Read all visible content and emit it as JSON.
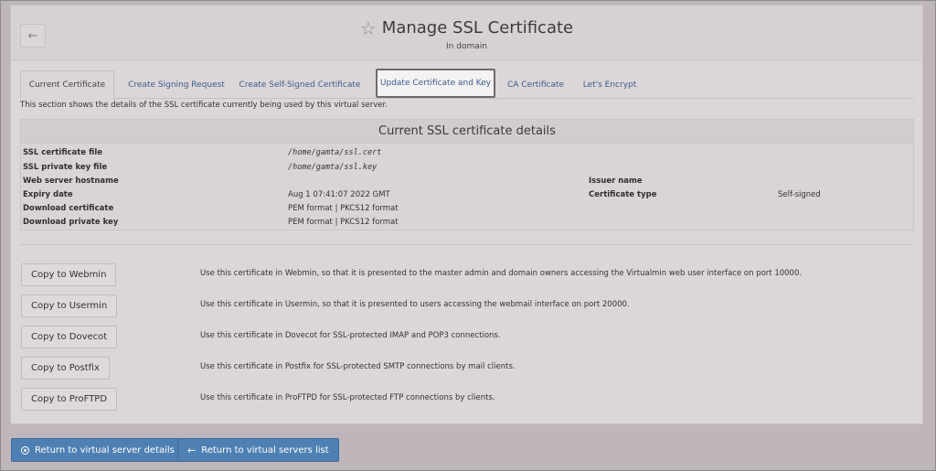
{
  "header": {
    "title": "Manage SSL Certificate",
    "subtitle": "In domain",
    "back_icon": "arrow-left-icon",
    "star_icon": "star-outline-icon"
  },
  "tabs": [
    {
      "label": "Current Certificate",
      "state": "active"
    },
    {
      "label": "Create Signing Request",
      "state": "normal"
    },
    {
      "label": "Create Self-Signed Certificate",
      "state": "normal"
    },
    {
      "label": "Update Certificate and Key",
      "state": "highlighted"
    },
    {
      "label": "CA Certificate",
      "state": "normal"
    },
    {
      "label": "Let's Encrypt",
      "state": "normal"
    }
  ],
  "intro": "This section shows the details of the SSL certificate currently being used by this virtual server.",
  "details": {
    "heading": "Current SSL certificate details",
    "rows": [
      {
        "label": "SSL certificate file",
        "value": "/home/gamta/ssl.cert"
      },
      {
        "label": "SSL private key file",
        "value": "/home/gamta/ssl.key"
      },
      {
        "label": "Web server hostname",
        "value": ""
      },
      {
        "label": "Expiry date",
        "value": "Aug 1 07:41:07 2022 GMT"
      },
      {
        "label": "Download certificate",
        "value": "PEM format | PKCS12 format"
      },
      {
        "label": "Download private key",
        "value": "PEM format | PKCS12 format"
      }
    ],
    "right_rows": [
      {
        "label": "Issuer name",
        "value": ""
      },
      {
        "label": "Certificate type",
        "value": "Self-signed"
      }
    ]
  },
  "copy_actions": [
    {
      "button": "Copy to Webmin",
      "description": "Use this certificate in Webmin, so that it is presented to the master admin and domain owners accessing the Virtualmin web user interface on port 10000."
    },
    {
      "button": "Copy to Usermin",
      "description": "Use this certificate in Usermin, so that it is presented to users accessing the webmail interface on port 20000."
    },
    {
      "button": "Copy to Dovecot",
      "description": "Use this certificate in Dovecot for SSL-protected IMAP and POP3 connections."
    },
    {
      "button": "Copy to Postfix",
      "description": "Use this certificate in Postfix for SSL-protected SMTP connections by mail clients."
    },
    {
      "button": "Copy to ProFTPD",
      "description": "Use this certificate in ProFTPD for SSL-protected FTP connections by clients."
    }
  ],
  "footer": {
    "return_details": "Return to virtual server details",
    "return_list": "Return to virtual servers list"
  },
  "colors": {
    "primary_button": "#4f80b3",
    "link": "#3a5d8c",
    "overlay_background": "#bfb6bb"
  }
}
